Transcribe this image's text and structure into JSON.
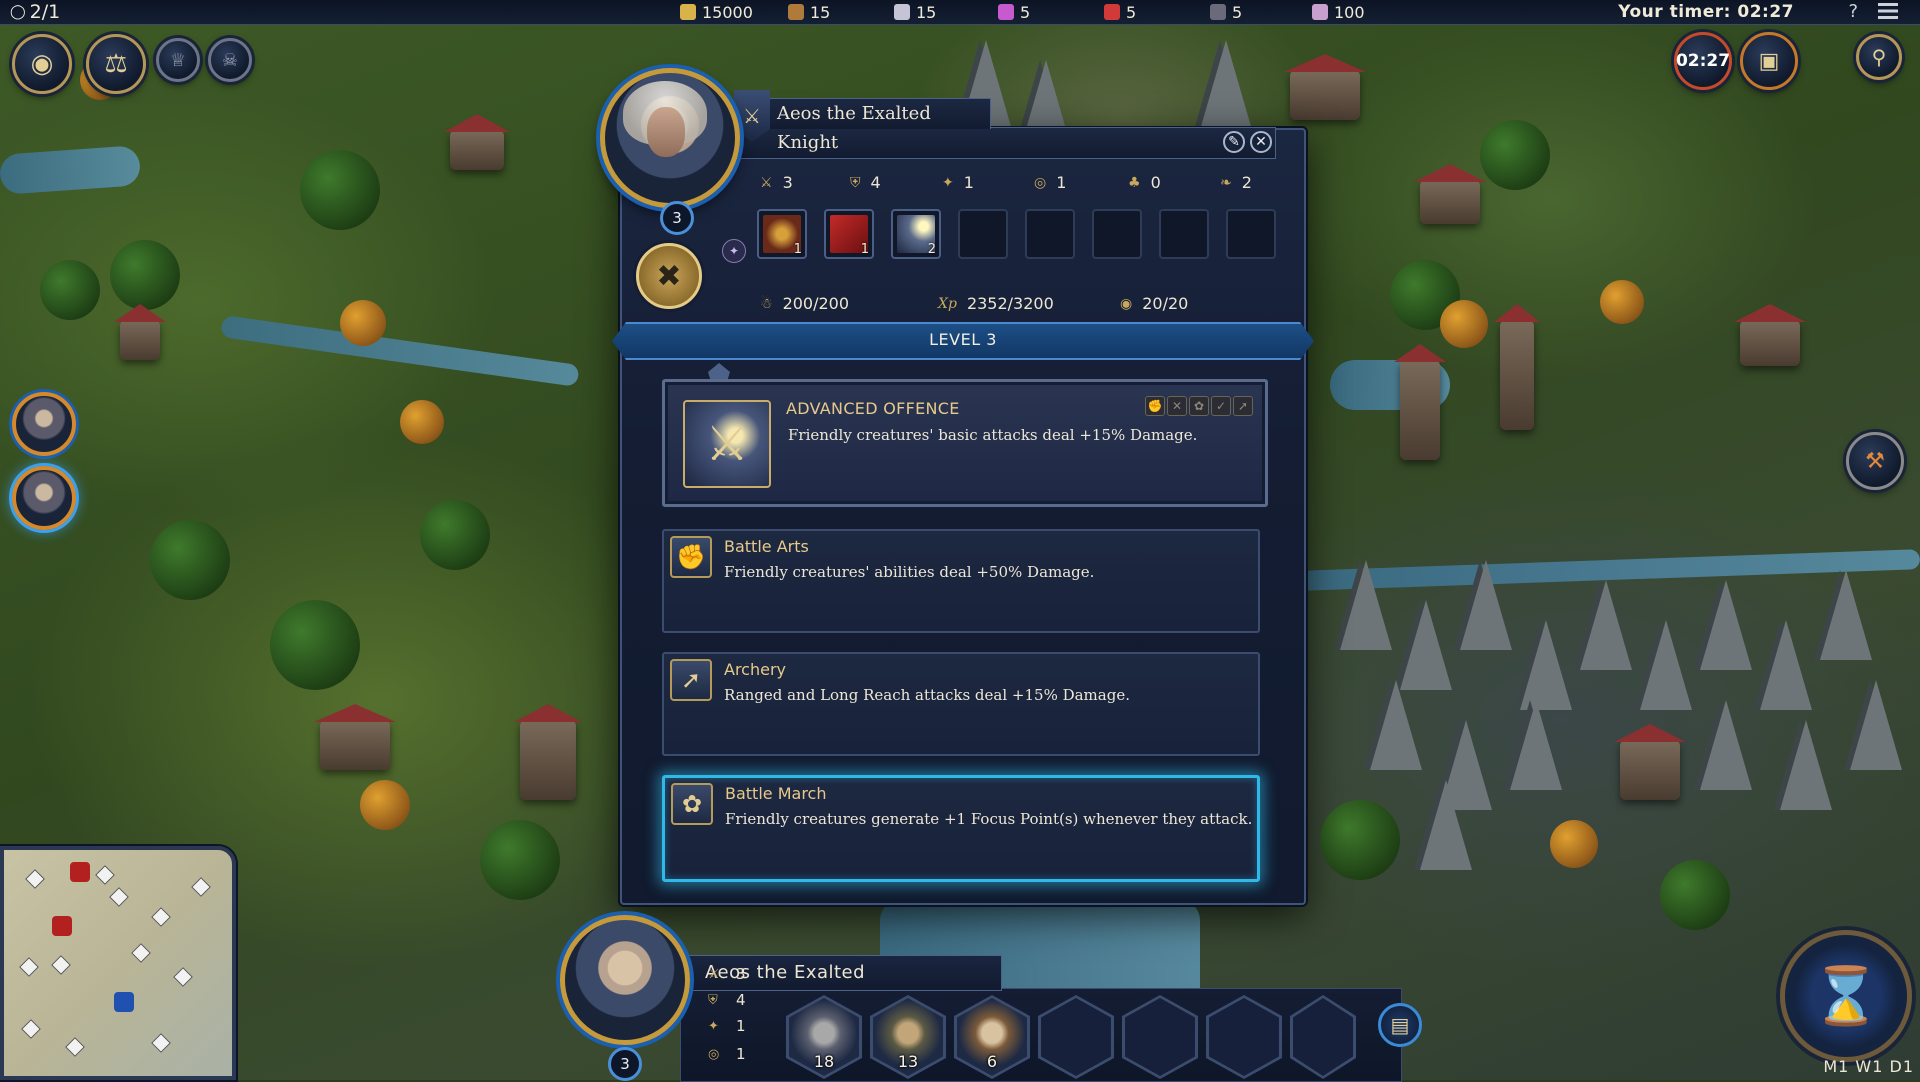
{
  "topbar": {
    "players": "2/1",
    "resources": [
      {
        "icon": "gold-icon",
        "value": "15000",
        "color": "#d8b24a"
      },
      {
        "icon": "wood-icon",
        "value": "15",
        "color": "#b07a3a"
      },
      {
        "icon": "ore-icon",
        "value": "15",
        "color": "#c4c4d4"
      },
      {
        "icon": "crystal-icon",
        "value": "5",
        "color": "#c85ad0"
      },
      {
        "icon": "mercury-icon",
        "value": "5",
        "color": "#d23a3a"
      },
      {
        "icon": "gem-icon",
        "value": "5",
        "color": "#6a6a7a"
      },
      {
        "icon": "dust-icon",
        "value": "100",
        "color": "#c8a0d0"
      }
    ],
    "timer_label": "Your timer: 02:27",
    "help_glyph": "?"
  },
  "top_left_buttons": [
    "vision-icon",
    "balance-icon",
    "crown-icon",
    "reaper-icon"
  ],
  "top_right": {
    "timer": "02:27"
  },
  "hero_dialog": {
    "name": "Aeos the Exalted",
    "class": "Knight",
    "level_badge": "3",
    "stats": [
      {
        "icon": "attack-icon",
        "value": "3"
      },
      {
        "icon": "defense-icon",
        "value": "4"
      },
      {
        "icon": "spellpower-icon",
        "value": "1"
      },
      {
        "icon": "knowledge-icon",
        "value": "1"
      },
      {
        "icon": "luck-icon",
        "value": "0"
      },
      {
        "icon": "morale-icon",
        "value": "2"
      }
    ],
    "slots": [
      {
        "count": "1",
        "art": "caduceus"
      },
      {
        "count": "1",
        "art": "banner"
      },
      {
        "count": "2",
        "art": "sword"
      },
      {
        "count": ""
      },
      {
        "count": ""
      },
      {
        "count": ""
      },
      {
        "count": ""
      },
      {
        "count": ""
      }
    ],
    "movement": "200/200",
    "experience": "2352/3200",
    "mana": "20/20",
    "level_banner": "LEVEL 3",
    "skills": {
      "featured": {
        "title": "ADVANCED OFFENCE",
        "description": "Friendly creatures' basic attacks deal +15% Damage."
      },
      "options": [
        {
          "title": "Battle Arts",
          "description": "Friendly creatures' abilities deal +50% Damage."
        },
        {
          "title": "Archery",
          "description": "Ranged and Long Reach attacks deal +15% Damage."
        },
        {
          "title": "Battle March",
          "description": "Friendly creatures generate +1 Focus Point(s) whenever they attack."
        }
      ]
    }
  },
  "bottom_panel": {
    "hero_name": "Aeos the Exalted",
    "level": "3",
    "stats": [
      "3",
      "4",
      "1",
      "1"
    ],
    "units": [
      {
        "count": "18",
        "icon": "knight-unit-icon"
      },
      {
        "count": "13",
        "icon": "crossbowman-unit-icon"
      },
      {
        "count": "6",
        "icon": "griffin-unit-icon"
      }
    ]
  },
  "calendar": "M1  W1  D1"
}
